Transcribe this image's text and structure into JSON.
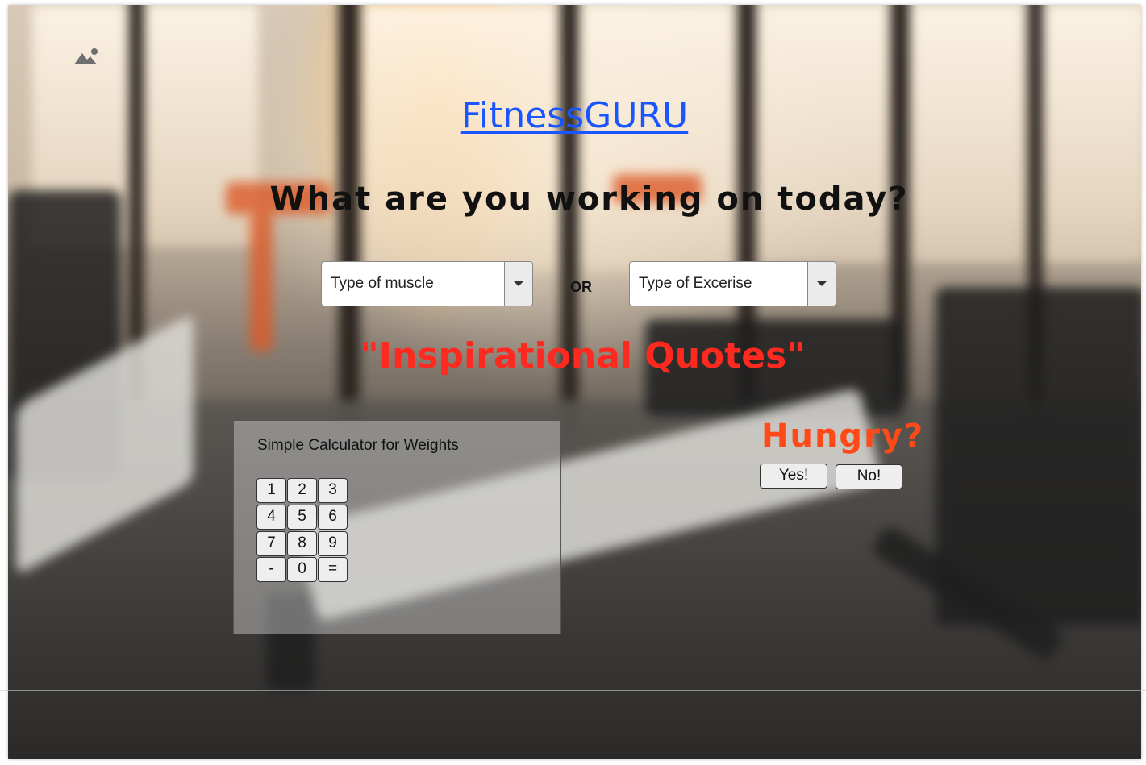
{
  "brand": {
    "title": "FitnessGURU"
  },
  "main": {
    "headline": "What are you working on today?",
    "muscle_select": {
      "selected": "Type of muscle"
    },
    "or_label": "OR",
    "exercise_select": {
      "selected": "Type of Excerise"
    },
    "quotes_heading": "\"Inspirational Quotes\""
  },
  "calculator": {
    "title": "Simple Calculator for Weights",
    "keys": [
      "1",
      "2",
      "3",
      "4",
      "5",
      "6",
      "7",
      "8",
      "9",
      "-",
      "0",
      "="
    ]
  },
  "hungry": {
    "heading": "Hungry?",
    "yes_label": "Yes!",
    "no_label": "No!"
  },
  "icons": {
    "top_left": "image-placeholder-icon",
    "select_arrow": "caret-down-icon"
  },
  "colors": {
    "brand_link": "#1a56ff",
    "quotes": "#ff2a1f",
    "hungry": "#ff4a18",
    "headline": "#111111"
  }
}
